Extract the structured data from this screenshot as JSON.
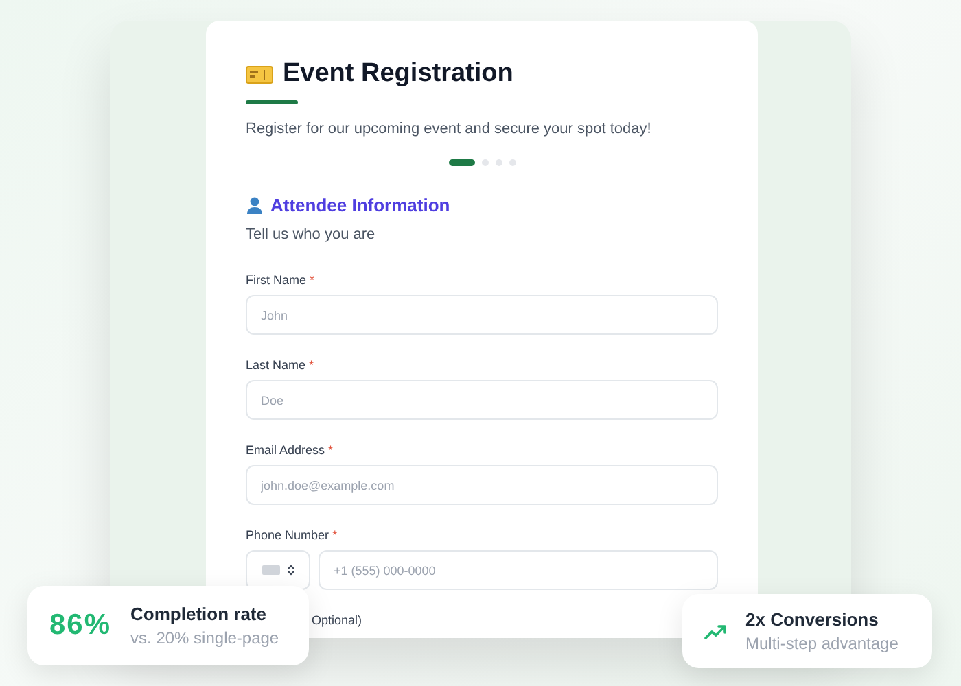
{
  "form": {
    "title": "Event Registration",
    "subtitle": "Register for our upcoming event and secure your spot today!",
    "steps": [
      {
        "selected": true
      },
      {
        "selected": false
      },
      {
        "selected": false
      },
      {
        "selected": false
      }
    ],
    "section": {
      "title": "Attendee Information",
      "subtitle": "Tell us who you are"
    },
    "fields": [
      {
        "kind": "text",
        "label": "First Name",
        "required_mark": "*",
        "placeholder": "John"
      },
      {
        "kind": "text",
        "label": "Last Name",
        "required_mark": "*",
        "placeholder": "Doe"
      },
      {
        "kind": "text",
        "label": "Email Address",
        "required_mark": "*",
        "placeholder": "john.doe@example.com"
      },
      {
        "kind": "phone",
        "label": "Phone Number",
        "required_mark": "*",
        "placeholder": "+1 (555) 000-0000"
      },
      {
        "kind": "partial",
        "label": "Optional)"
      }
    ]
  },
  "badges": [
    {
      "kind": "percent",
      "value": "86%",
      "title": "Completion rate",
      "subtitle": "vs. 20% single-page"
    },
    {
      "kind": "trend",
      "title": "2x Conversions",
      "subtitle": "Multi-step advantage"
    }
  ]
}
